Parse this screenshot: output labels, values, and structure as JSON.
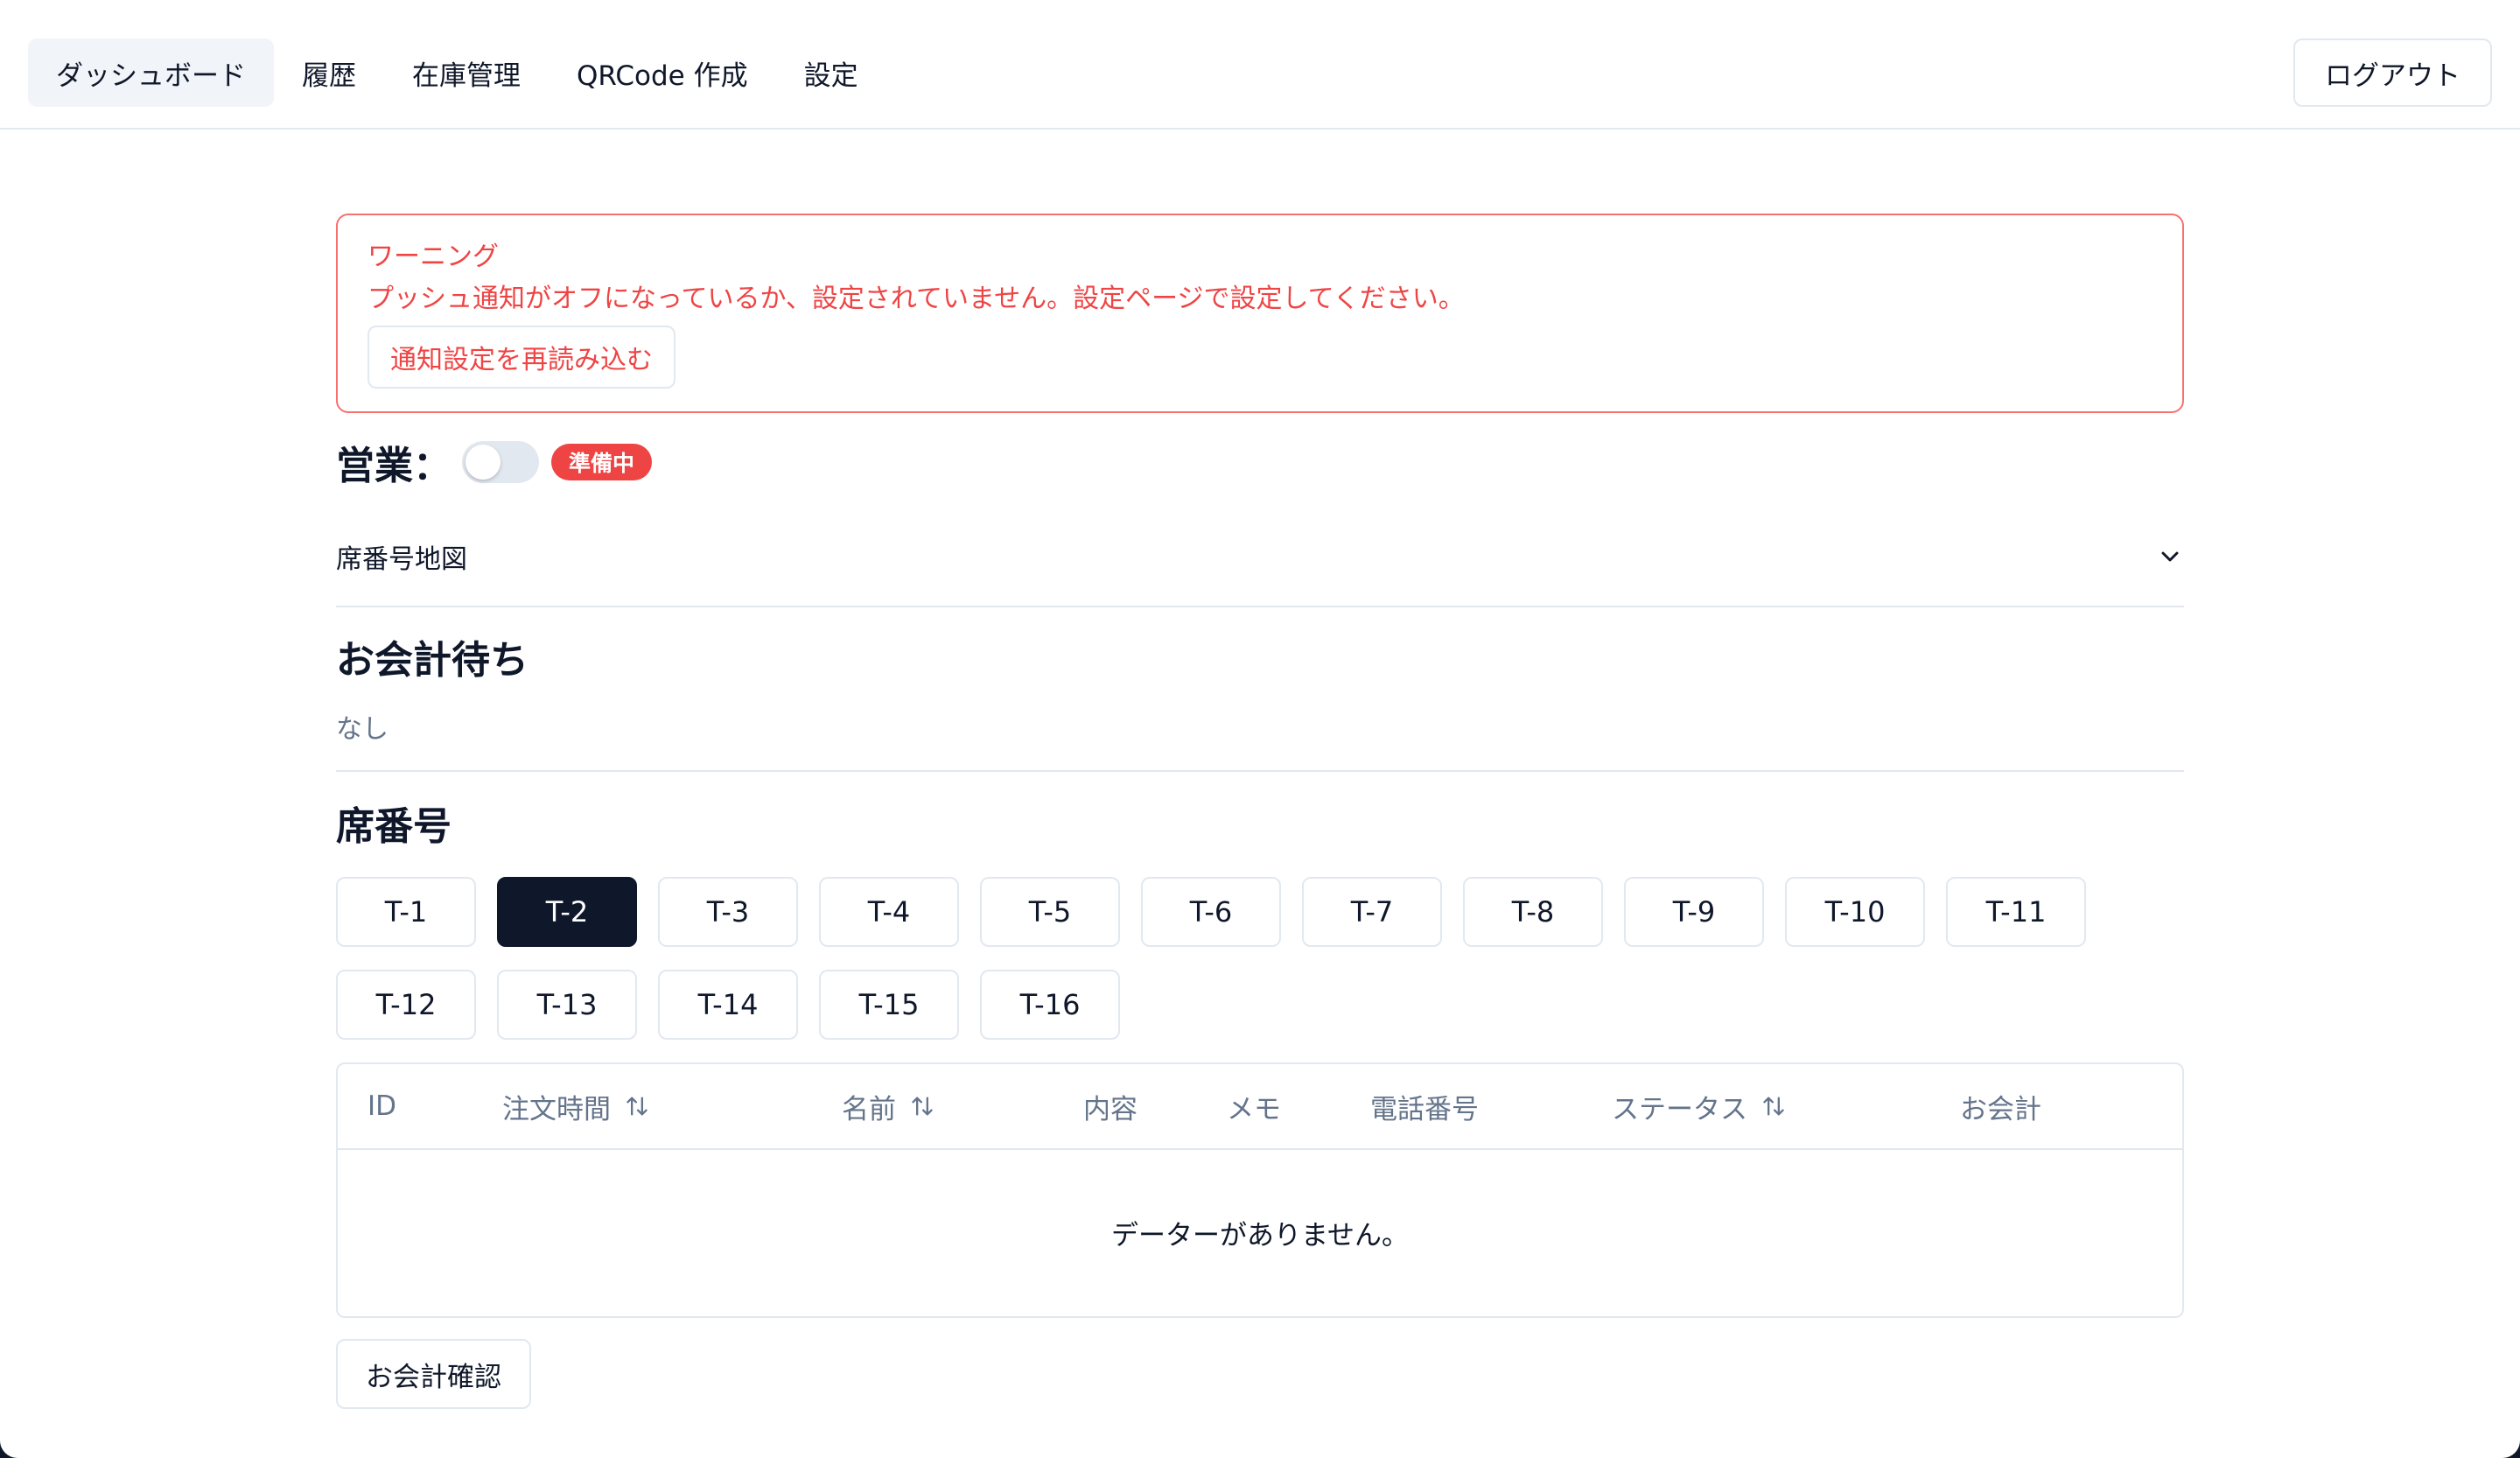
{
  "nav": {
    "items": [
      {
        "label": "ダッシュボード"
      },
      {
        "label": "履歴"
      },
      {
        "label": "在庫管理"
      },
      {
        "label": "QRCode 作成"
      },
      {
        "label": "設定"
      }
    ],
    "logout_label": "ログアウト"
  },
  "warning": {
    "title": "ワーニング",
    "message": "プッシュ通知がオフになっているか、設定されていません。設定ページで設定してください。",
    "reload_label": "通知設定を再読み込む"
  },
  "business": {
    "label": "営業：",
    "status": "準備中",
    "toggle_on": false
  },
  "seat_map": {
    "title": "席番号地図",
    "icon": "chevron-down-icon"
  },
  "pay_wait": {
    "title": "お会計待ち",
    "empty": "なし"
  },
  "seats": {
    "title": "席番号",
    "items": [
      {
        "label": "T-1"
      },
      {
        "label": "T-2"
      },
      {
        "label": "T-3"
      },
      {
        "label": "T-4"
      },
      {
        "label": "T-5"
      },
      {
        "label": "T-6"
      },
      {
        "label": "T-7"
      },
      {
        "label": "T-8"
      },
      {
        "label": "T-9"
      },
      {
        "label": "T-10"
      },
      {
        "label": "T-11"
      },
      {
        "label": "T-12"
      },
      {
        "label": "T-13"
      },
      {
        "label": "T-14"
      },
      {
        "label": "T-15"
      },
      {
        "label": "T-16"
      }
    ],
    "selected": "T-2"
  },
  "table": {
    "columns": [
      "ID",
      "注文時間",
      "名前",
      "内容",
      "メモ",
      "電話番号",
      "ステータス",
      "お会計"
    ],
    "empty_message": "データーがありません。"
  },
  "checkout_confirm_label": "お会計確認",
  "colors": {
    "danger": "#ef4444",
    "primary": "#0f172a",
    "muted": "#64748b",
    "border": "#e2e8f0"
  }
}
